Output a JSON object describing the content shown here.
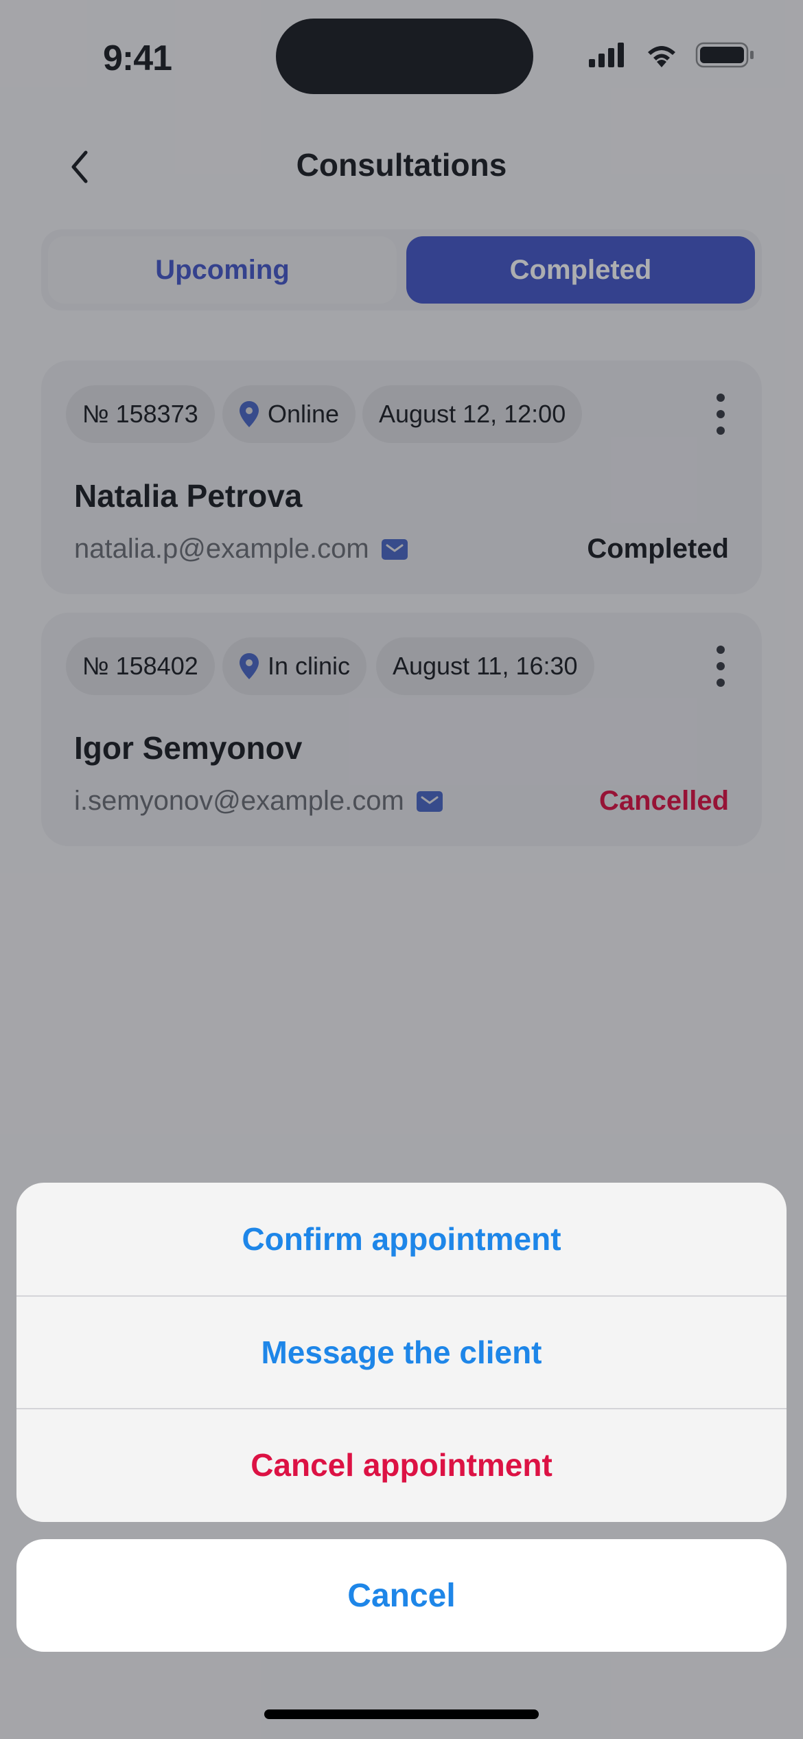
{
  "status_bar": {
    "time": "9:41"
  },
  "nav": {
    "title": "Consultations",
    "back_icon": "chevron-left-icon"
  },
  "tabs": [
    {
      "label": "Upcoming",
      "selected": false
    },
    {
      "label": "Completed",
      "selected": true
    }
  ],
  "consultations": [
    {
      "number": "№ 158373",
      "location": "Online",
      "datetime": "August 12, 12:00",
      "client_name": "Natalia Petrova",
      "email": "natalia.p@example.com",
      "status": "Completed",
      "status_color": "#1c1f26"
    },
    {
      "number": "№ 158402",
      "location": "In clinic",
      "datetime": "August 11, 16:30",
      "client_name": "Igor Semyonov",
      "email": "i.semyonov@example.com",
      "status": "Cancelled",
      "status_color": "#dc1244"
    }
  ],
  "action_sheet": {
    "actions": [
      {
        "label": "Confirm appointment",
        "color": "#1e86e8"
      },
      {
        "label": "Message the client",
        "color": "#1e86e8"
      },
      {
        "label": "Cancel appointment",
        "color": "#dc1244"
      }
    ],
    "cancel_label": "Cancel"
  },
  "colors": {
    "accent": "#4558c9",
    "link": "#1e86e8",
    "destructive": "#dc1244"
  }
}
